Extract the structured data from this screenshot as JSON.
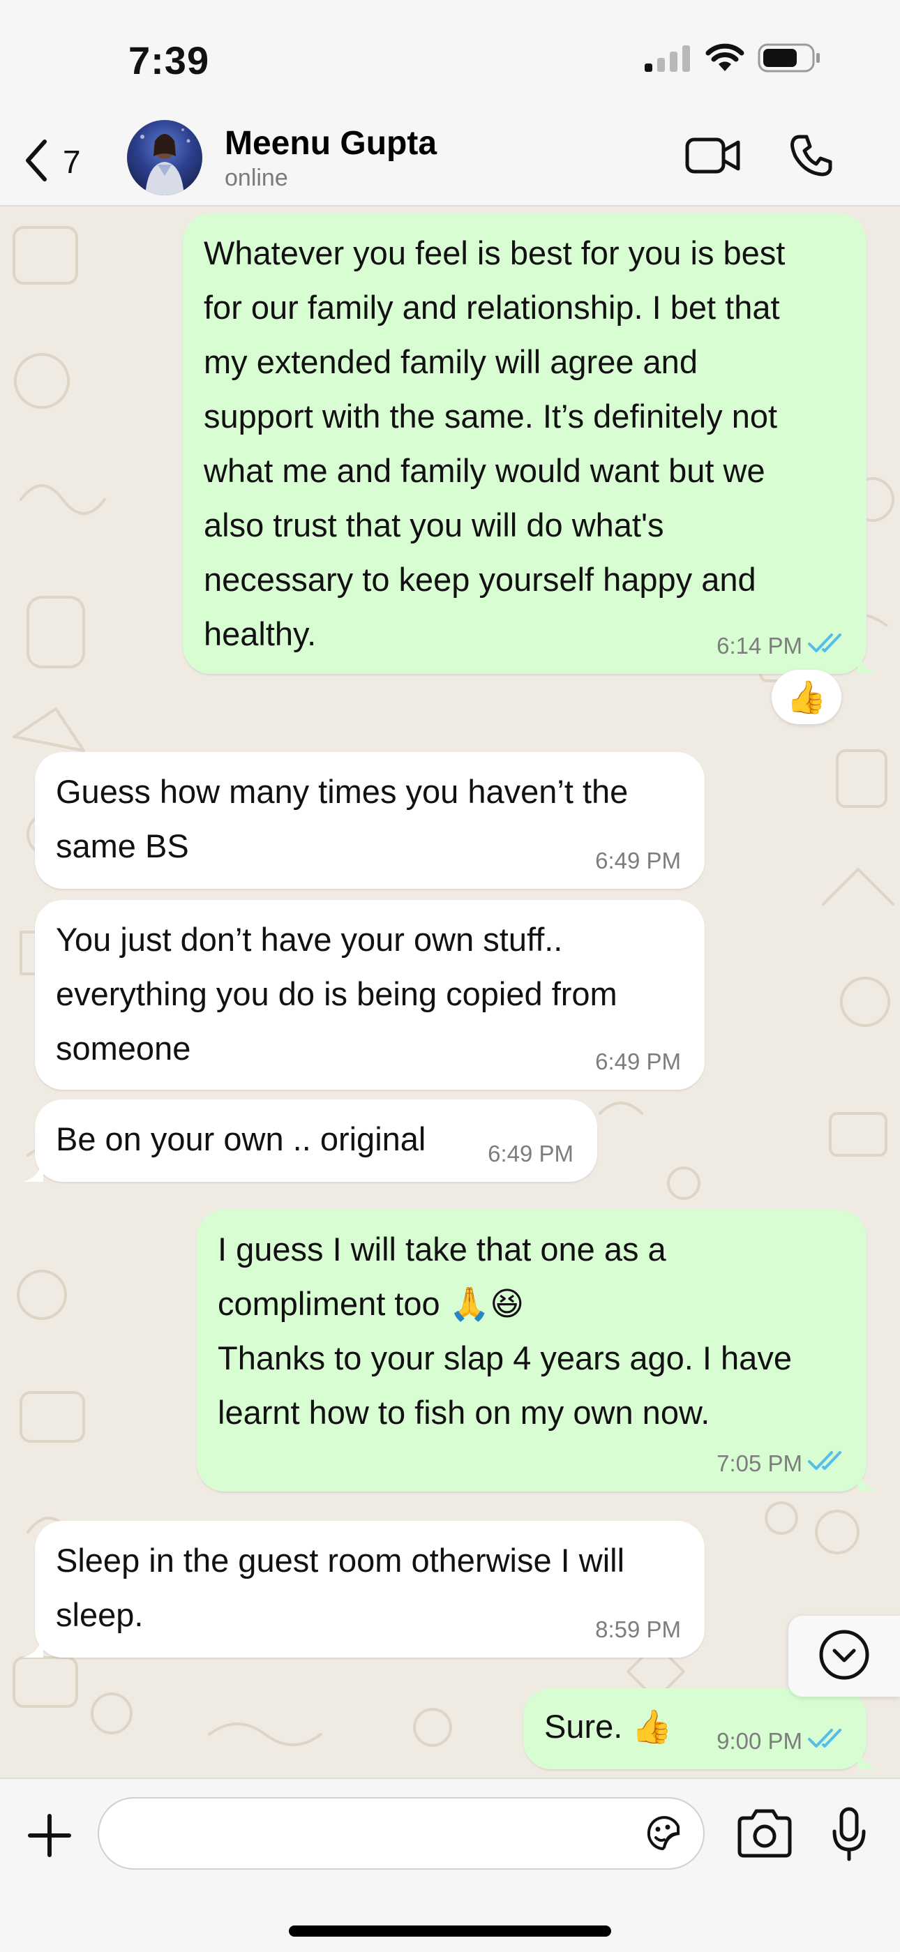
{
  "status_bar": {
    "time": "7:39",
    "icons": [
      "signal-icon",
      "wifi-icon",
      "battery-icon"
    ]
  },
  "header": {
    "back_count": "7",
    "contact_name": "Meenu Gupta",
    "contact_status": "online",
    "icons": [
      "back-chevron-icon",
      "video-camera-icon",
      "phone-icon"
    ]
  },
  "messages": [
    {
      "direction": "outgoing",
      "text": "Whatever you feel is best for you is best\nfor our family and relationship. I bet that\nmy extended family will agree and\nsupport with the same. It’s definitely not\nwhat me and family would want but we\nalso trust that you will do what's\nnecessary to keep yourself happy and\nhealthy.",
      "time": "6:14 PM",
      "status": "read",
      "reaction": "👍"
    },
    {
      "direction": "incoming",
      "text": "Guess how many times you haven’t the\nsame BS",
      "time": "6:49 PM"
    },
    {
      "direction": "incoming",
      "text": "You just don’t have your own stuff..\neverything you do is being copied from\nsomeone",
      "time": "6:49 PM"
    },
    {
      "direction": "incoming",
      "text": "Be on your own .. original",
      "time": "6:49 PM"
    },
    {
      "direction": "outgoing",
      "text": "I guess I will take that one as a\ncompliment too 🙏😆\nThanks to your slap 4 years ago. I have\nlearnt how to fish on my own now.",
      "time": "7:05 PM",
      "status": "read"
    },
    {
      "direction": "incoming",
      "text": "Sleep in the guest room otherwise I will\nsleep.",
      "time": "8:59 PM"
    },
    {
      "direction": "outgoing",
      "text": "Sure. 👍",
      "time": "9:00 PM",
      "status": "read"
    }
  ],
  "composer": {
    "placeholder": "",
    "icons": [
      "plus-icon",
      "sticker-icon",
      "camera-icon",
      "microphone-icon"
    ]
  },
  "colors": {
    "outgoing_bubble": "#d9fdd3",
    "incoming_bubble": "#ffffff",
    "chat_background": "#efeae2",
    "read_ticks": "#53bdeb",
    "bar_background": "#f6f6f6"
  }
}
